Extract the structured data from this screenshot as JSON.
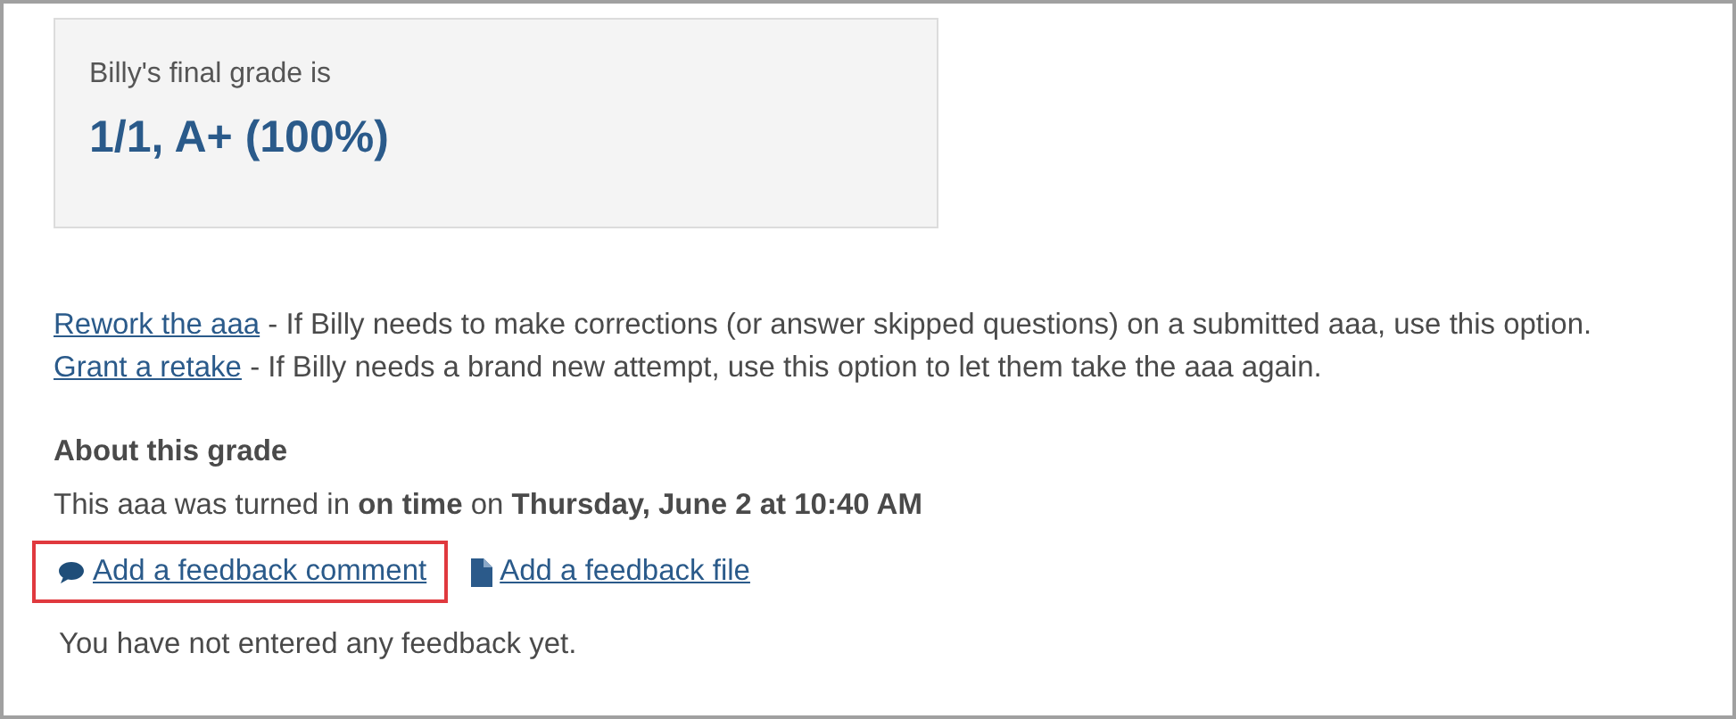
{
  "grade_card": {
    "label": "Billy's final grade is",
    "grade": "1/1, A+ (100%)"
  },
  "options": [
    {
      "link": "Rework the aaa",
      "description": "- If Billy needs to make corrections (or answer skipped questions) on a submitted aaa, use this option."
    },
    {
      "link": "Grant a retake",
      "description": "- If Billy needs a brand new attempt, use this option to let them take the aaa again."
    }
  ],
  "about": {
    "heading": "About this grade",
    "status": "This aaa was turned in **on time** on **Thursday, June 2 at 10:40 AM**"
  },
  "feedback_links": [
    {
      "kind": "comment",
      "label": "Add a feedback comment",
      "highlighted": true
    },
    {
      "kind": "file",
      "label": "Add a feedback file",
      "highlighted": false
    }
  ],
  "feedback_note": "You have not entered any feedback yet."
}
